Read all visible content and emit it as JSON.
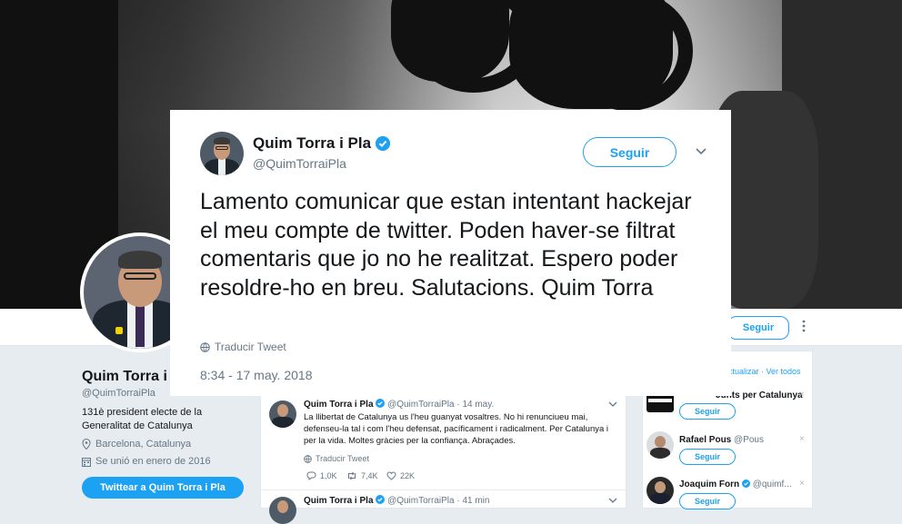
{
  "card": {
    "name": "Quim Torra i Pla",
    "handle": "@QuimTorraiPla",
    "follow_label": "Seguir",
    "text": "Lamento comunicar que estan intentant hackejar el meu compte de twitter. Poden haver-se filtrat comentaris que jo no he realitzat. Espero poder resoldre-ho en breu. Salutacions. Quim Torra",
    "translate_label": "Traducir Tweet",
    "timestamp": "8:34 - 17 may. 2018"
  },
  "profile": {
    "name": "Quim Torra i P",
    "handle": "@QuimTorraiPla",
    "bio": "131è president electe de la Generalitat de Catalunya",
    "location": "Barcelona, Catalunya",
    "joined": "Se unió en enero de 2016",
    "tweet_to_label": "Twittear a Quim Torra i Pla",
    "follow_label": "Seguir"
  },
  "timeline": [
    {
      "name": "Quim Torra i Pla",
      "handle": "@QuimTorraiPla · 14 may.",
      "text": "La llibertat de Catalunya us l'heu guanyat vosaltres. No hi renunciueu mai, defenseu-la tal i com l'heu defensat, pacíficament i radicalment. Per Catalunya i per la vida. Moltes gràcies per la confiança. Abraçades.",
      "translate_label": "Traducir Tweet",
      "replies": "1,0K",
      "retweets": "7,4K",
      "likes": "22K"
    },
    {
      "name": "Quim Torra i Pla",
      "handle": "@QuimTorraiPla · 41 min"
    }
  ],
  "sidebar": {
    "header": "ctualizar · Ver todos",
    "follow_label": "Seguir",
    "suggestions": [
      {
        "name": "Junts per Catalunya",
        "handle": ""
      },
      {
        "name": "Rafael Pous",
        "handle": "@Pous"
      },
      {
        "name": "Joaquim Forn",
        "handle": "@quimf..."
      }
    ]
  },
  "colors": {
    "accent": "#1da1f2",
    "text": "#14171a",
    "muted": "#657786"
  }
}
